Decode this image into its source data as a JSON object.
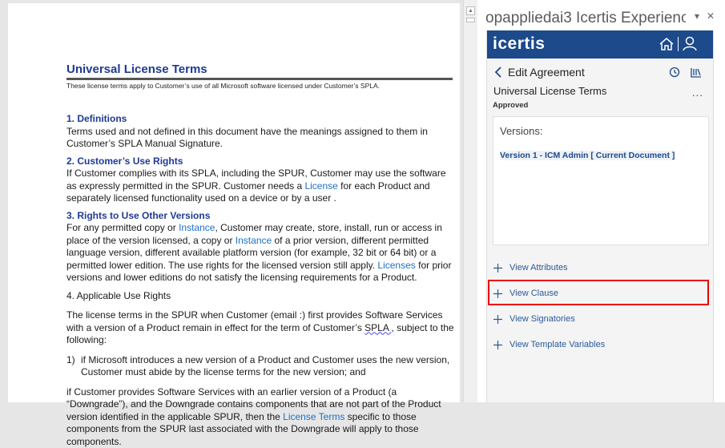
{
  "document": {
    "title": "Universal License Terms",
    "subtitle": "These license terms apply to Customer’s use of all Microsoft software licensed under Customer’s SPLA.",
    "s1_heading": "1. Definitions",
    "s1_body": "Terms used and not defined in this document have the meanings assigned to them in Customer’s SPLA Manual Signature.",
    "s2_heading": "2. Customer’s Use Rights",
    "s2_a": "If Customer complies with its SPLA, including the SPUR, Customer may use the software as expressly permitted in the SPUR. Customer needs a ",
    "s2_link": "License",
    "s2_b": " for each Product and separately licensed functionality used on a device or by a user .",
    "s3_heading": "3. Rights to Use Other Versions",
    "s3_a": "For any permitted copy or ",
    "s3_link1": "Instance",
    "s3_b": ", Customer may create, store, install, run or access in place of the version licensed, a copy or ",
    "s3_link2": "Instance",
    "s3_c": " of a prior version, different permitted language version, different available platform version (for example, 32 bit or 64 bit) or a permitted lower edition. The use rights for the licensed version still apply. ",
    "s3_link3": "Licenses",
    "s3_d": " for prior versions and lower editions do not satisfy the licensing requirements for a Product.",
    "s4_heading": "4. Applicable Use Rights",
    "s4_a": "The license terms in the SPUR when Customer (email :) first provides Software Services with a version of a Product remain in effect for the term of Customer’s ",
    "s4_squig": "SPLA ,",
    "s4_b": " subject to the following:",
    "list1_num": "1)",
    "list1_text": "if Microsoft introduces a new version  of a Product and Customer uses the new version, Customer must abide by the license terms for the new version; and",
    "p_last_a": "if Customer provides Software Services with an earlier version of a Product (a “Downgrade”), and the Downgrade contains components that are not part of the Product version identified in the applicable SPUR, then the ",
    "p_last_link": "License Terms",
    "p_last_b": " specific to those components from the SPUR last associated with the Downgrade will apply to those components."
  },
  "pane": {
    "title": "opappliedai3 Icertis Experienc...",
    "dropdown_glyph": "▾",
    "close_glyph": "✕",
    "brand": "icertis",
    "nav_label": "Edit Agreement",
    "agreement_title": "Universal License Terms",
    "status": "Approved",
    "more_glyph": "...",
    "versions_heading": "Versions:",
    "version_item": "Version 1 - ICM Admin [ Current Document ]",
    "actions": [
      {
        "label": "View Attributes"
      },
      {
        "label": "View Clause"
      },
      {
        "label": "View Signatories"
      },
      {
        "label": "View Template Variables"
      }
    ]
  },
  "colors": {
    "brand_bar": "#1c4a8a",
    "heading_blue": "#1f3a93",
    "link_blue": "#1f6fc6",
    "highlight_red": "#e00000"
  }
}
